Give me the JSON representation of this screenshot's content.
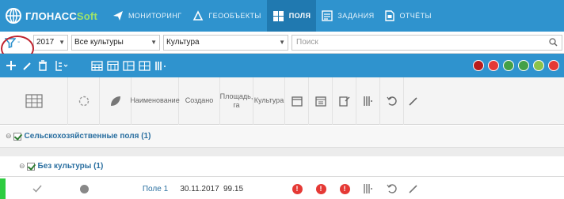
{
  "app": {
    "logo_main": "ГЛОНАСС",
    "logo_soft": "Soft"
  },
  "nav": [
    {
      "label": "МОНИТОРИНГ",
      "icon": "send-icon",
      "active": false
    },
    {
      "label": "ГЕООБЪЕКТЫ",
      "icon": "geoobject-icon",
      "active": false
    },
    {
      "label": "ПОЛЯ",
      "icon": "fields-icon",
      "active": true
    },
    {
      "label": "ЗАДАНИЯ",
      "icon": "tasks-icon",
      "active": false
    },
    {
      "label": "ОТЧЁТЫ",
      "icon": "reports-icon",
      "active": false
    }
  ],
  "filters": {
    "year": "2017",
    "crops": "Все культуры",
    "crop_type": "Культура",
    "search_placeholder": "Поиск"
  },
  "status_colors": [
    "#b71c1c",
    "#e53935",
    "#43a047",
    "#43a047",
    "#8bc34a",
    "#e53935"
  ],
  "columns": {
    "name": "Наименование",
    "created": "Создано",
    "area": "Площадь, га",
    "crop": "Культура"
  },
  "groups": {
    "agri": "Сельскохозяйственные поля (1)",
    "no_crop": "Без культуры (1)"
  },
  "row": {
    "name": "Поле 1",
    "created": "30.11.2017",
    "area": "99.15"
  },
  "colors": {
    "header_blue": "#2f93ce",
    "active_tab": "#2079b0",
    "highlight_circle": "#c0242f",
    "row_marker": "#2ecc40",
    "alert_red": "#e53935"
  }
}
